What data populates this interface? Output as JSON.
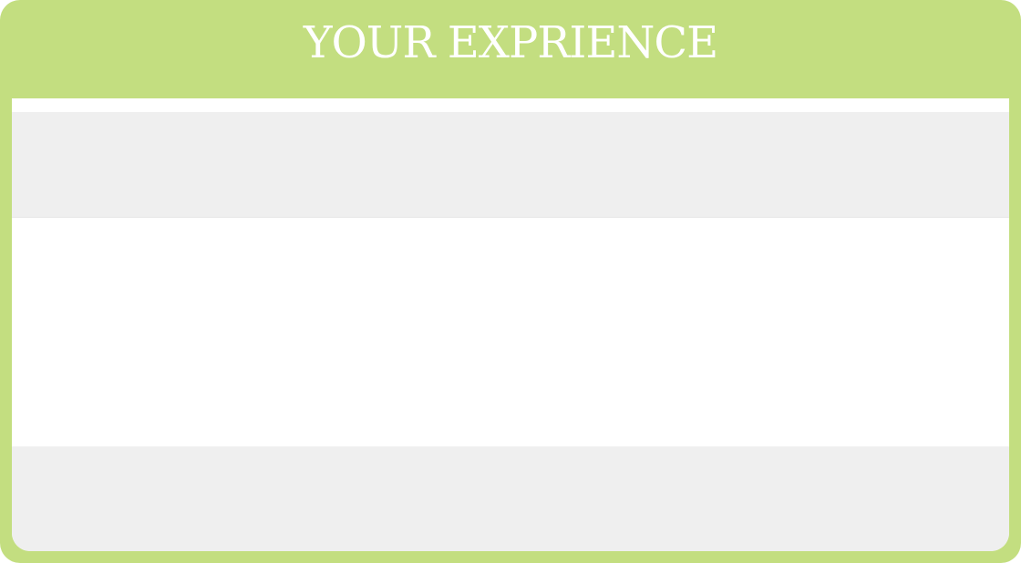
{
  "card": {
    "title": "YOUR EXPRIENCE"
  },
  "colors": {
    "accent": "#c3de80",
    "row_shade": "#efefef",
    "row_plain": "#ffffff",
    "title_text": "#ffffff"
  }
}
